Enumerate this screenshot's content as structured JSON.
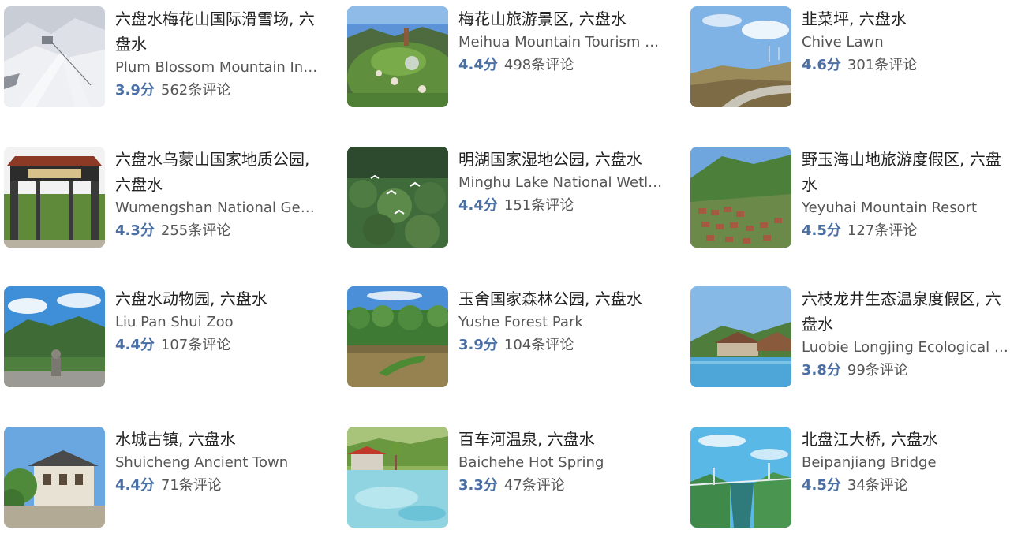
{
  "places": [
    {
      "title": "六盘水梅花山国际滑雪场, 六盘水",
      "subtitle": "Plum Blossom Mountain International Ski Resort",
      "score": "3.9分",
      "reviews": "562条评论",
      "image": "ski-resort-thumbnail"
    },
    {
      "title": "梅花山旅游景区, 六盘水",
      "subtitle": "Meihua Mountain Tourism Scenic Area",
      "score": "4.4分",
      "reviews": "498条评论",
      "image": "mountain-resort-thumbnail"
    },
    {
      "title": "韭菜坪, 六盘水",
      "subtitle": "Chive Lawn",
      "score": "4.6分",
      "reviews": "301条评论",
      "image": "hill-lawn-thumbnail"
    },
    {
      "title": "六盘水乌蒙山国家地质公园, 六盘水",
      "subtitle": "Wumengshan National Geopark",
      "score": "4.3分",
      "reviews": "255条评论",
      "image": "gate-thumbnail"
    },
    {
      "title": "明湖国家湿地公园, 六盘水",
      "subtitle": "Minghu Lake National Wetland Park",
      "score": "4.4分",
      "reviews": "151条评论",
      "image": "wetland-birds-thumbnail"
    },
    {
      "title": "野玉海山地旅游度假区, 六盘水",
      "subtitle": "Yeyuhai Mountain Resort",
      "score": "4.5分",
      "reviews": "127条评论",
      "image": "mountain-village-thumbnail"
    },
    {
      "title": "六盘水动物园, 六盘水",
      "subtitle": "Liu Pan Shui Zoo",
      "score": "4.4分",
      "reviews": "107条评论",
      "image": "zoo-thumbnail"
    },
    {
      "title": "玉舍国家森林公园, 六盘水",
      "subtitle": "Yushe Forest Park",
      "score": "3.9分",
      "reviews": "104条评论",
      "image": "forest-lake-thumbnail"
    },
    {
      "title": "六枝龙井生态温泉度假区, 六盘水",
      "subtitle": "Luobie Longjing Ecological Hot Spring Resort",
      "score": "3.8分",
      "reviews": "99条评论",
      "image": "pool-resort-thumbnail"
    },
    {
      "title": "水城古镇, 六盘水",
      "subtitle": "Shuicheng Ancient Town",
      "score": "4.4分",
      "reviews": "71条评论",
      "image": "ancient-town-thumbnail"
    },
    {
      "title": "百车河温泉, 六盘水",
      "subtitle": "Baichehe Hot Spring",
      "score": "3.3分",
      "reviews": "47条评论",
      "image": "hot-spring-thumbnail"
    },
    {
      "title": "北盘江大桥, 六盘水",
      "subtitle": "Beipanjiang Bridge",
      "score": "4.5分",
      "reviews": "34条评论",
      "image": "bridge-thumbnail"
    }
  ],
  "colors": {
    "score": "#4a6fa5",
    "title": "#222222",
    "subtitle": "#555555"
  }
}
